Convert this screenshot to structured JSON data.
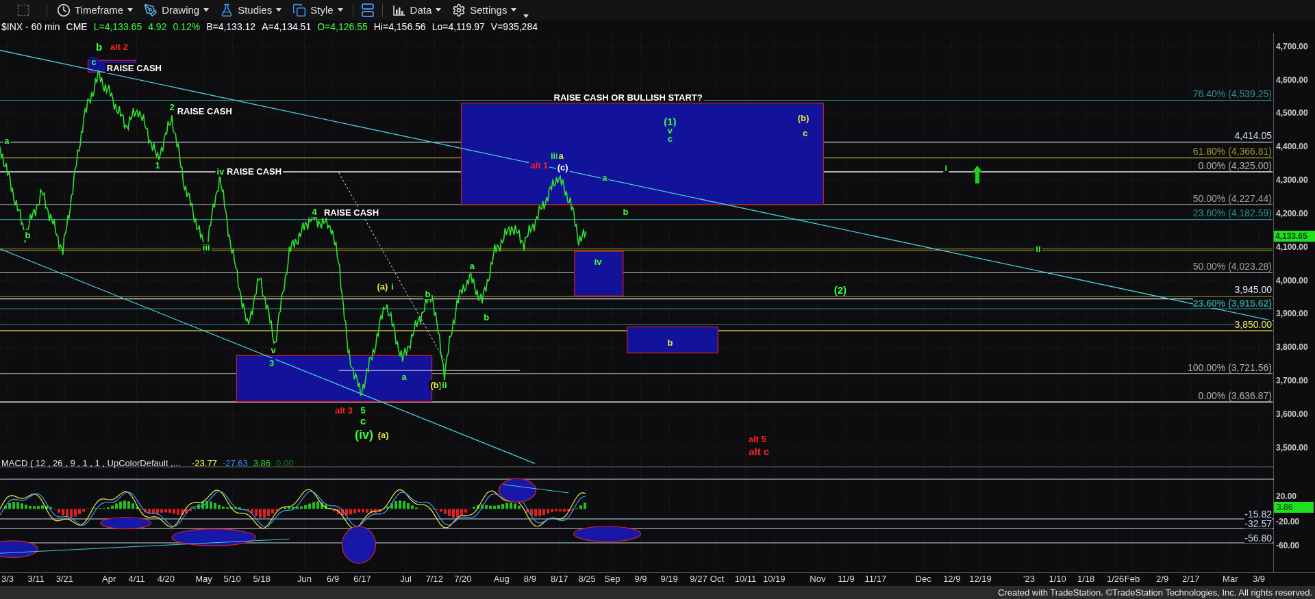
{
  "toolbar": {
    "items": [
      {
        "label": "Timeframe"
      },
      {
        "label": "Drawing"
      },
      {
        "label": "Studies"
      },
      {
        "label": "Style"
      },
      {
        "label": "Data"
      },
      {
        "label": "Settings"
      }
    ]
  },
  "symbol_bar": [
    {
      "text": "$INX - 60 min",
      "color": "#ffffff"
    },
    {
      "text": "CME",
      "color": "#ffffff"
    },
    {
      "text": "L=4,133.65",
      "color": "#3cff3c"
    },
    {
      "text": "4.92",
      "color": "#3cff3c"
    },
    {
      "text": "0.12%",
      "color": "#3cff3c"
    },
    {
      "text": "B=4,133.12",
      "color": "#ffffff"
    },
    {
      "text": "A=4,134.51",
      "color": "#ffffff"
    },
    {
      "text": "O=4,126.55",
      "color": "#3cff3c"
    },
    {
      "text": "Hi=4,156.56",
      "color": "#ffffff"
    },
    {
      "text": "Lo=4,119.97",
      "color": "#ffffff"
    },
    {
      "text": "V=935,284",
      "color": "#ffffff"
    }
  ],
  "annotations": [
    {
      "text": "b",
      "color": "#3cff3c"
    },
    {
      "text": "alt 2",
      "color": "#ff2020"
    },
    {
      "text": "c",
      "color": "#3cff3c"
    },
    {
      "text": "RAISE CASH",
      "color": "#ffffff"
    },
    {
      "text": "a",
      "color": "#3cff3c"
    },
    {
      "text": "b",
      "color": "#3cff3c"
    },
    {
      "text": "2",
      "color": "#3cff3c"
    },
    {
      "text": "RAISE CASH",
      "color": "#ffffff"
    },
    {
      "text": "1",
      "color": "#3cff3c"
    },
    {
      "text": "iv",
      "color": "#3cff3c"
    },
    {
      "text": "RAISE CASH",
      "color": "#ffffff"
    },
    {
      "text": "iii",
      "color": "#3cff3c"
    },
    {
      "text": "v",
      "color": "#3cff3c"
    },
    {
      "text": "3",
      "color": "#3cff3c"
    },
    {
      "text": "4",
      "color": "#3cff3c"
    },
    {
      "text": "RAISE CASH",
      "color": "#ffffff"
    },
    {
      "text": "(a)",
      "color": "#e8e840"
    },
    {
      "text": "i",
      "color": "#3cff3c"
    },
    {
      "text": "b",
      "color": "#3cff3c"
    },
    {
      "text": "a",
      "color": "#3cff3c"
    },
    {
      "text": "(b)",
      "color": "#e8e840"
    },
    {
      "text": "ii",
      "color": "#3cff3c"
    },
    {
      "text": "a",
      "color": "#3cff3c"
    },
    {
      "text": "b",
      "color": "#3cff3c"
    },
    {
      "text": "alt 3",
      "color": "#ff2020"
    },
    {
      "text": "5",
      "color": "#3cff3c"
    },
    {
      "text": "c",
      "color": "#3cff3c"
    },
    {
      "text": "(iv)",
      "color": "#3cff3c"
    },
    {
      "text": "(a)",
      "color": "#e8e840"
    },
    {
      "text": "RAISE CASH OR BULLISH START?",
      "color": "#ffffff"
    },
    {
      "text": "(1)",
      "color": "#3cff3c"
    },
    {
      "text": "v",
      "color": "#3cff3c"
    },
    {
      "text": "c",
      "color": "#3cff3c"
    },
    {
      "text": "(b)",
      "color": "#e8e840"
    },
    {
      "text": "c",
      "color": "#e8e840"
    },
    {
      "text": "iii",
      "color": "#3cff3c"
    },
    {
      "text": "a",
      "color": "#e8e840"
    },
    {
      "text": "alt 1",
      "color": "#ff2020"
    },
    {
      "text": "(c)",
      "color": "#ffffff"
    },
    {
      "text": "a",
      "color": "#3cff3c"
    },
    {
      "text": "b",
      "color": "#3cff3c"
    },
    {
      "text": "iv",
      "color": "#3cff3c"
    },
    {
      "text": "b",
      "color": "#e8e840"
    },
    {
      "text": "(2)",
      "color": "#3cff3c"
    },
    {
      "text": "i",
      "color": "#3cff3c"
    },
    {
      "text": "ii",
      "color": "#3cff3c"
    },
    {
      "text": "alt 5",
      "color": "#ff2020"
    },
    {
      "text": "alt c",
      "color": "#ff2020"
    }
  ],
  "fib_levels": [
    {
      "text": "76.40% (4,539.25)",
      "color": "#2a9090"
    },
    {
      "text": "4,414.05",
      "color": "#c8d8f0"
    },
    {
      "text": "61.80% (4,366.81)",
      "color": "#9a9a30"
    },
    {
      "text": "0.00% (4,325.00)",
      "color": "#b0b0b0"
    },
    {
      "text": "50.00% (4,227.44)",
      "color": "#a0a0a0"
    },
    {
      "text": "23.60% (4,182.59)",
      "color": "#2a9090"
    },
    {
      "text": "50.00% (4,023.28)",
      "color": "#a0a0a0"
    },
    {
      "text": "3,945.00",
      "color": "#e0e8f8"
    },
    {
      "text": "23.60% (3,915.62)",
      "color": "#2a9090"
    },
    {
      "text": "3,850.00",
      "color": "#f0f060"
    },
    {
      "text": "100.00% (3,721.56)",
      "color": "#b0b0b0"
    },
    {
      "text": "0.00% (3,636.87)",
      "color": "#b0b0b0"
    }
  ],
  "price_axis": {
    "ticks": [
      "4,700.00",
      "4,600.00",
      "4,500.00",
      "4,400.00",
      "4,300.00",
      "4,200.00",
      "4,100.00",
      "4,000.00",
      "3,900.00",
      "3,800.00",
      "3,700.00",
      "3,600.00",
      "3,500.00"
    ],
    "last_price": "4,133.65"
  },
  "macd": {
    "title": "MACD ( 12 , 26 , 9 , 1 , 1 , UpColorDefault ,...",
    "values": [
      {
        "text": "-23.77",
        "color": "#ffff40"
      },
      {
        "text": "-27.63",
        "color": "#3c8cff"
      },
      {
        "text": "3.86",
        "color": "#20e020"
      },
      {
        "text": "0.00",
        "color": "#108010"
      }
    ],
    "levels": [
      "-15.82",
      "-32.57",
      "-56.80"
    ],
    "ticks": [
      "20.00",
      "-20.00",
      "-60.00"
    ],
    "last_value": "3.86"
  },
  "date_axis": [
    "3/3",
    "3/11",
    "3/21",
    "Apr",
    "4/11",
    "4/20",
    "May",
    "5/10",
    "5/18",
    "Jun",
    "6/9",
    "6/17",
    "Jul",
    "7/12",
    "7/20",
    "Aug",
    "8/9",
    "8/17",
    "8/25",
    "Sep",
    "9/9",
    "9/19",
    "9/27",
    "Oct",
    "10/11",
    "10/19",
    "Nov",
    "11/9",
    "11/17",
    "Dec",
    "12/9",
    "12/19",
    "'23",
    "1/10",
    "1/18",
    "1/26",
    "Feb",
    "2/9",
    "2/17",
    "Mar",
    "3/9"
  ],
  "footer": "Created with TradeStation. ©TradeStation Technologies, Inc. All rights reserved."
}
